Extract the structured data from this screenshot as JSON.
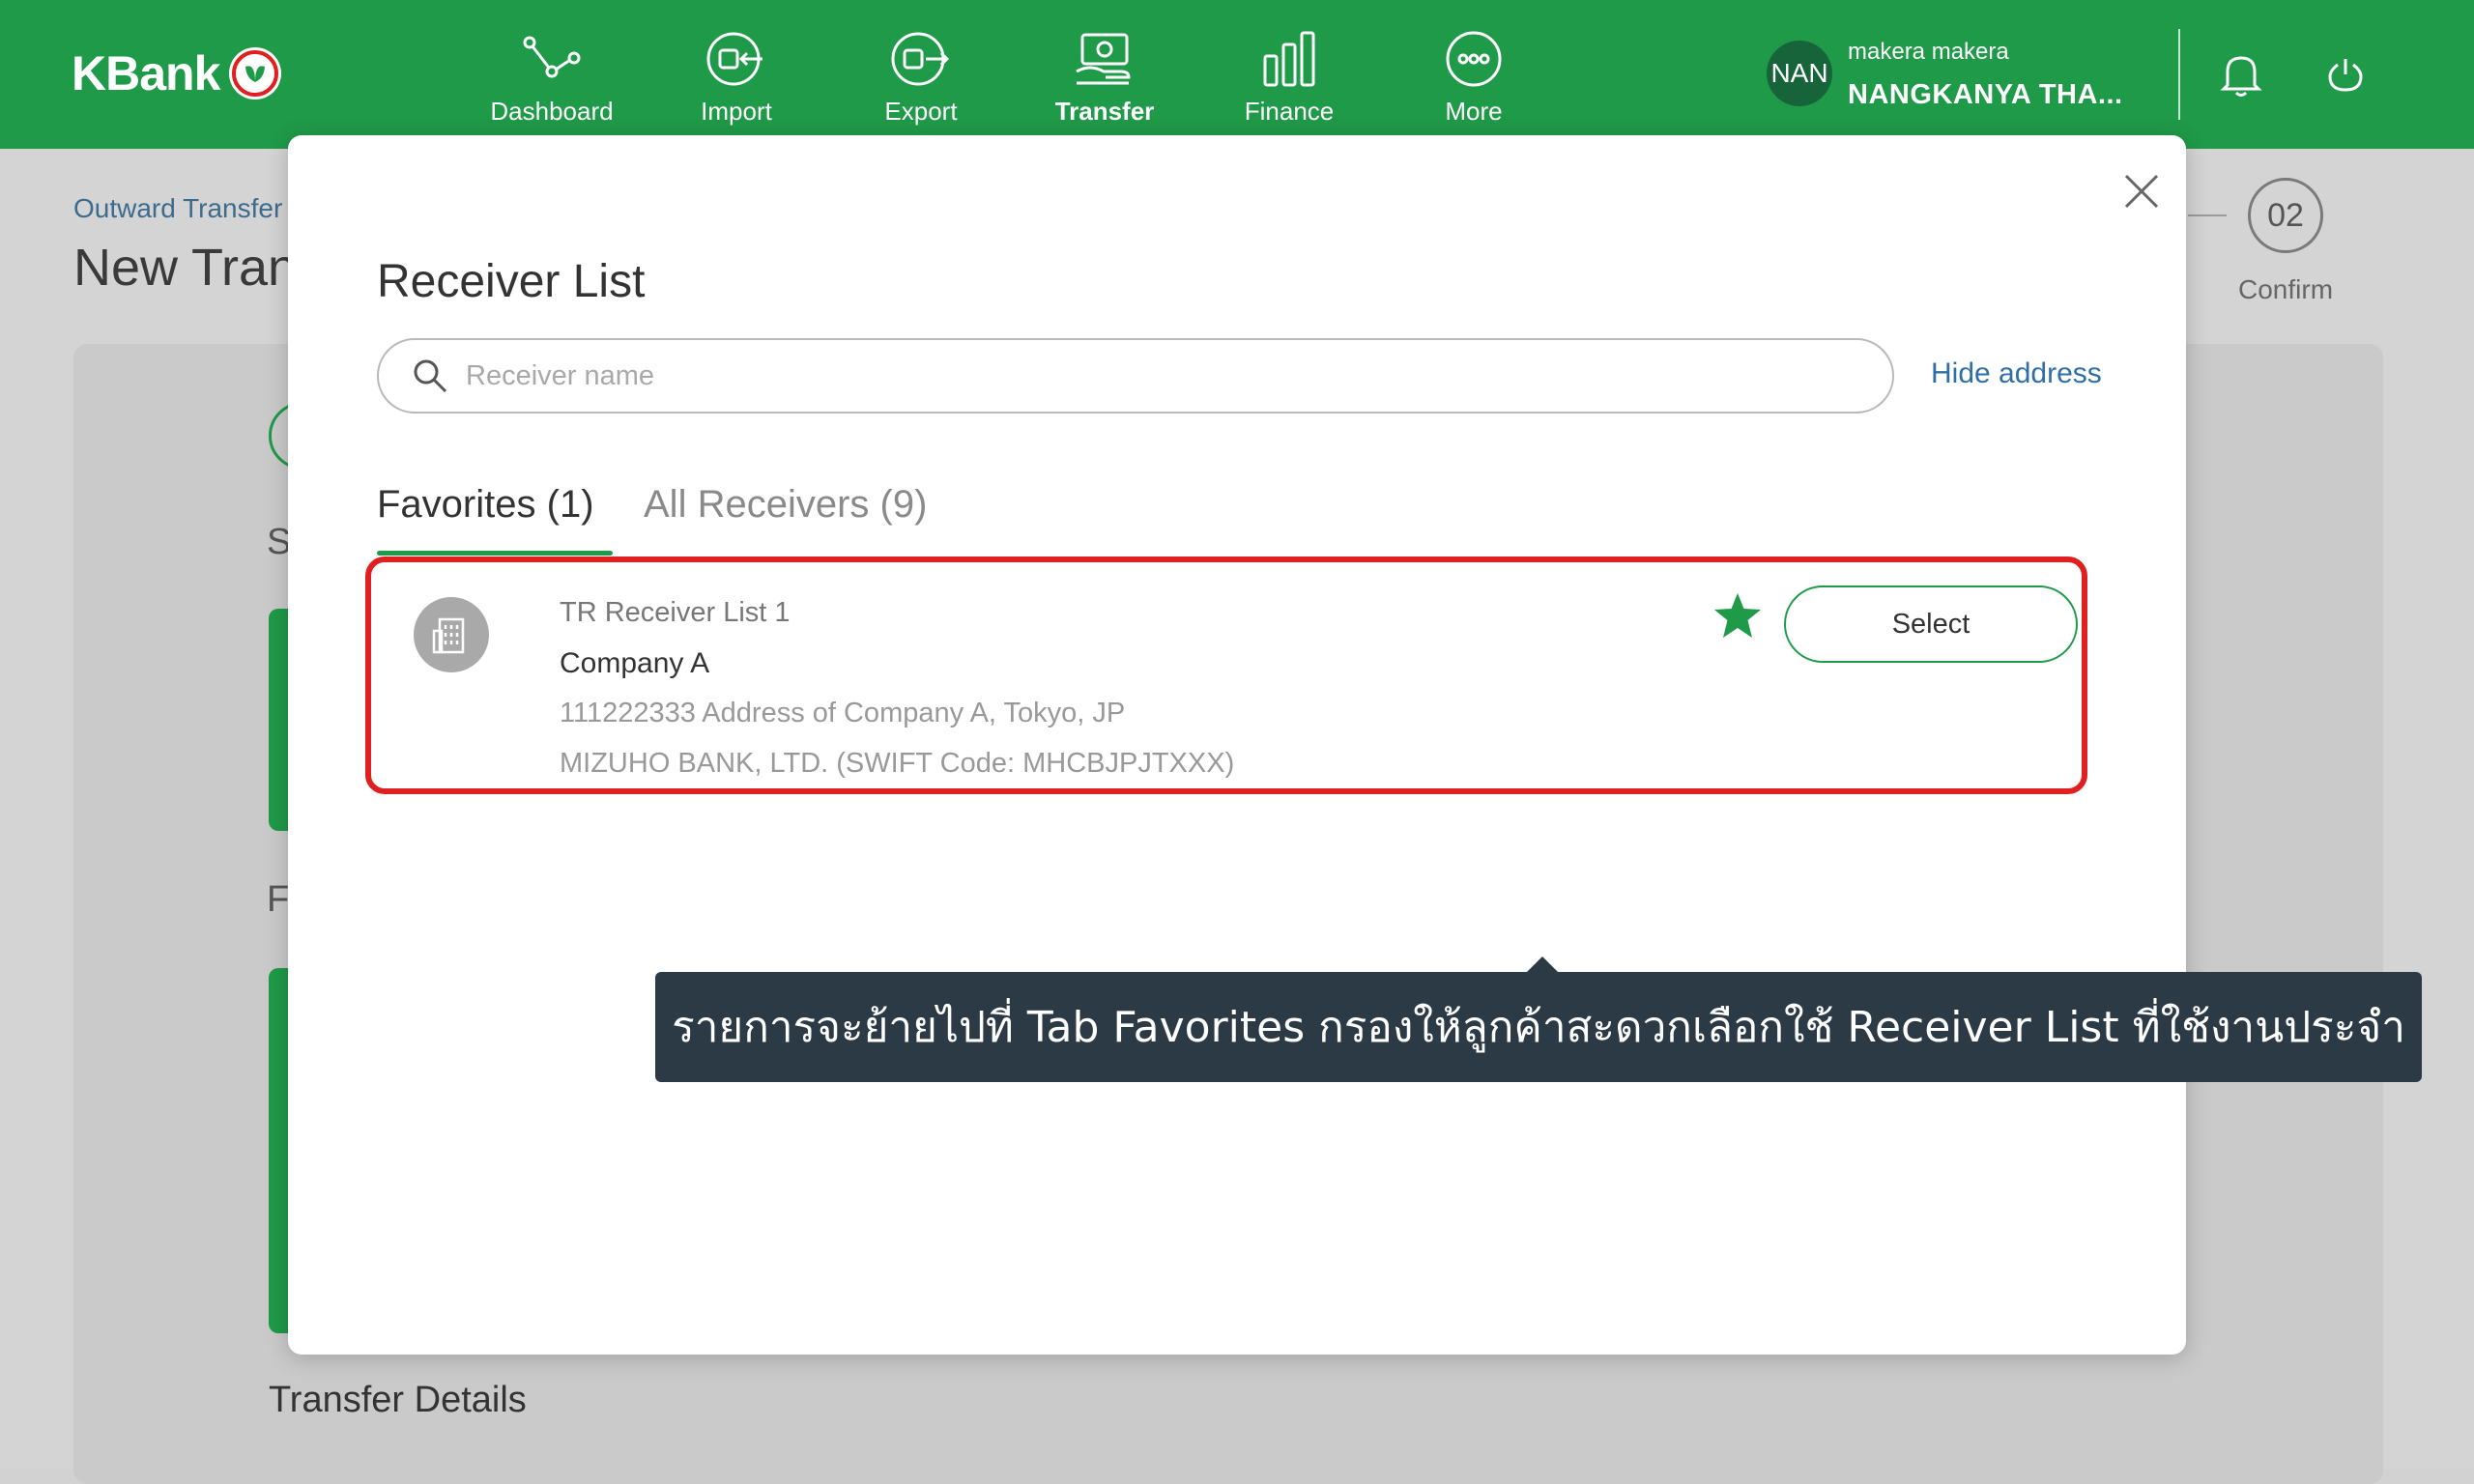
{
  "brand": {
    "logo_text": "KBank",
    "primary_color": "#1f9a48",
    "alert_color": "#e02020",
    "link_color": "#2f6fa6"
  },
  "nav": {
    "items": [
      {
        "label": "Dashboard",
        "icon": "dashboard-icon"
      },
      {
        "label": "Import",
        "icon": "import-icon"
      },
      {
        "label": "Export",
        "icon": "export-icon"
      },
      {
        "label": "Transfer",
        "icon": "transfer-icon",
        "active": true
      },
      {
        "label": "Finance",
        "icon": "finance-icon"
      },
      {
        "label": "More",
        "icon": "more-icon"
      }
    ],
    "avatar_initials": "NAN",
    "user_role": "makera makera",
    "user_name": "NANGKANYA THA..."
  },
  "background_page": {
    "breadcrumb": "Outward Transfer",
    "title": "New Tran",
    "step_number": "02",
    "step_label": "Confirm",
    "section_letter_1": "S",
    "section_letter_2": "F",
    "section_title": "Transfer Details"
  },
  "modal": {
    "title": "Receiver List",
    "search": {
      "placeholder": "Receiver name",
      "value": ""
    },
    "hide_address_label": "Hide address",
    "tabs": [
      {
        "label": "Favorites",
        "count": "(1)",
        "active": true
      },
      {
        "label": "All Receivers",
        "count": "(9)",
        "active": false
      }
    ],
    "receivers": [
      {
        "name": "TR Receiver List 1",
        "company": "Company A",
        "address": "111222333 Address of Company A, Tokyo, JP",
        "bank": "MIZUHO BANK, LTD. (SWIFT Code: MHCBJPJTXXX)",
        "favorite": true,
        "select_label": "Select"
      }
    ]
  },
  "tooltip": {
    "text": "รายการจะย้ายไปที่ Tab Favorites กรองให้ลูกค้าสะดวกเลือกใช้ Receiver List ที่ใช้งานประจำ"
  }
}
